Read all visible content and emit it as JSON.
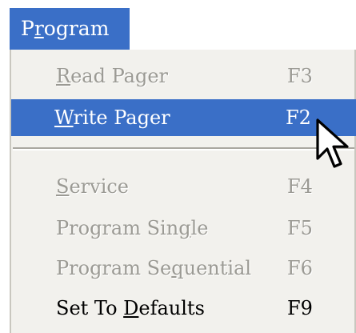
{
  "menu": {
    "title": {
      "first": "P",
      "underline": "r",
      "rest": "ogram"
    },
    "items": [
      {
        "pre": "",
        "mnemonic": "R",
        "post": "ead Pager",
        "shortcut": "F3",
        "state": "disabled"
      },
      {
        "pre": "",
        "mnemonic": "W",
        "post": "rite Pager",
        "shortcut": "F2",
        "state": "highlighted"
      },
      {
        "pre": "",
        "mnemonic": "S",
        "post": "ervice",
        "shortcut": "F4",
        "state": "disabled"
      },
      {
        "pre": "Program Sin",
        "mnemonic": "g",
        "post": "le",
        "shortcut": "F5",
        "state": "disabled"
      },
      {
        "pre": "Program Se",
        "mnemonic": "q",
        "post": "uential",
        "shortcut": "F6",
        "state": "disabled"
      },
      {
        "pre": "Set To ",
        "mnemonic": "D",
        "post": "efaults",
        "shortcut": "F9",
        "state": "enabled"
      }
    ]
  },
  "colors": {
    "highlight": "#3a6fc7",
    "menu_background": "#f2f1ed",
    "disabled_text": "#9b9a94"
  },
  "icons": {
    "cursor": "mouse-pointer-arrow-icon"
  }
}
